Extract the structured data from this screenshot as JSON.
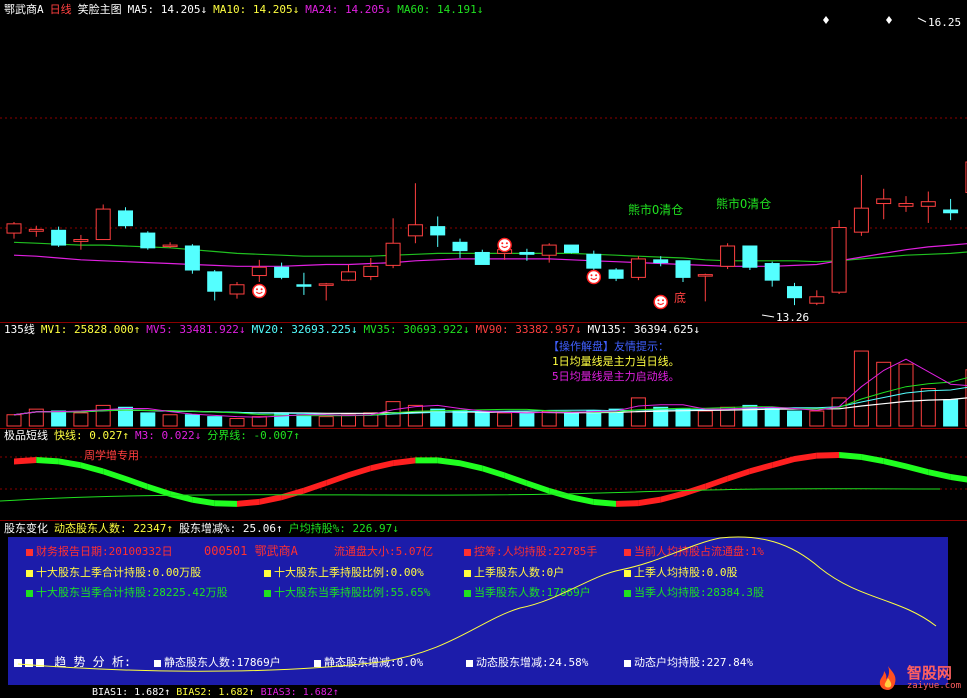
{
  "main": {
    "stock_name": "鄂武商A",
    "period": "日线",
    "indicator": "笑脸主图",
    "ma5": "MA5: 14.205↓",
    "ma10": "MA10: 14.205↓",
    "ma24": "MA24: 14.205↓",
    "ma60": "MA60: 14.191↓",
    "high_price": "16.25",
    "low_price": "13.26",
    "bear_label_1": "熊市O清仓",
    "bear_label_2": "熊市O清仓",
    "bottom_label": "底",
    "colors": {
      "up": "#ff4040",
      "down": "#54ffff",
      "ma_green": "#20c020",
      "ma_magenta": "#e020e0"
    },
    "candles": [
      {
        "o": 14.02,
        "c": 14.12,
        "h": 14.14,
        "l": 13.96
      },
      {
        "o": 14.04,
        "c": 14.06,
        "h": 14.1,
        "l": 13.98
      },
      {
        "o": 14.05,
        "c": 13.89,
        "h": 14.09,
        "l": 13.87
      },
      {
        "o": 13.93,
        "c": 13.95,
        "h": 14.0,
        "l": 13.84
      },
      {
        "o": 13.95,
        "c": 14.28,
        "h": 14.33,
        "l": 13.95
      },
      {
        "o": 14.26,
        "c": 14.1,
        "h": 14.3,
        "l": 14.07
      },
      {
        "o": 14.02,
        "c": 13.86,
        "h": 14.04,
        "l": 13.84
      },
      {
        "o": 13.88,
        "c": 13.89,
        "h": 13.92,
        "l": 13.86
      },
      {
        "o": 13.88,
        "c": 13.62,
        "h": 13.9,
        "l": 13.58
      },
      {
        "o": 13.6,
        "c": 13.39,
        "h": 13.62,
        "l": 13.29
      },
      {
        "o": 13.36,
        "c": 13.46,
        "h": 13.49,
        "l": 13.31
      },
      {
        "o": 13.56,
        "c": 13.65,
        "h": 13.73,
        "l": 13.49
      },
      {
        "o": 13.65,
        "c": 13.54,
        "h": 13.7,
        "l": 13.52
      },
      {
        "o": 13.46,
        "c": 13.45,
        "h": 13.59,
        "l": 13.35
      },
      {
        "o": 13.46,
        "c": 13.47,
        "h": 13.48,
        "l": 13.29
      },
      {
        "o": 13.51,
        "c": 13.6,
        "h": 13.68,
        "l": 13.5
      },
      {
        "o": 13.55,
        "c": 13.66,
        "h": 13.75,
        "l": 13.51
      },
      {
        "o": 13.67,
        "c": 13.91,
        "h": 14.18,
        "l": 13.64
      },
      {
        "o": 13.99,
        "c": 14.11,
        "h": 14.56,
        "l": 13.91
      },
      {
        "o": 14.09,
        "c": 14.0,
        "h": 14.2,
        "l": 13.87
      },
      {
        "o": 13.92,
        "c": 13.83,
        "h": 13.96,
        "l": 13.75
      },
      {
        "o": 13.81,
        "c": 13.68,
        "h": 13.84,
        "l": 13.68
      },
      {
        "o": 13.8,
        "c": 13.84,
        "h": 13.88,
        "l": 13.73
      },
      {
        "o": 13.81,
        "c": 13.79,
        "h": 13.85,
        "l": 13.72
      },
      {
        "o": 13.78,
        "c": 13.89,
        "h": 13.91,
        "l": 13.7
      },
      {
        "o": 13.89,
        "c": 13.81,
        "h": 13.89,
        "l": 13.8
      },
      {
        "o": 13.79,
        "c": 13.64,
        "h": 13.83,
        "l": 13.59
      },
      {
        "o": 13.62,
        "c": 13.53,
        "h": 13.64,
        "l": 13.5
      },
      {
        "o": 13.54,
        "c": 13.74,
        "h": 13.77,
        "l": 13.51
      },
      {
        "o": 13.73,
        "c": 13.7,
        "h": 13.77,
        "l": 13.66
      },
      {
        "o": 13.72,
        "c": 13.54,
        "h": 13.72,
        "l": 13.49
      },
      {
        "o": 13.57,
        "c": 13.57,
        "h": 13.58,
        "l": 13.28
      },
      {
        "o": 13.66,
        "c": 13.88,
        "h": 13.91,
        "l": 13.63
      },
      {
        "o": 13.88,
        "c": 13.65,
        "h": 13.88,
        "l": 13.62
      },
      {
        "o": 13.69,
        "c": 13.51,
        "h": 13.71,
        "l": 13.44
      },
      {
        "o": 13.44,
        "c": 13.32,
        "h": 13.48,
        "l": 13.24
      },
      {
        "o": 13.26,
        "c": 13.33,
        "h": 13.4,
        "l": 13.24
      },
      {
        "o": 13.38,
        "c": 14.08,
        "h": 14.16,
        "l": 13.36
      },
      {
        "o": 14.03,
        "c": 14.29,
        "h": 14.65,
        "l": 13.99
      },
      {
        "o": 14.34,
        "c": 14.39,
        "h": 14.5,
        "l": 14.17
      },
      {
        "o": 14.31,
        "c": 14.34,
        "h": 14.42,
        "l": 14.25
      },
      {
        "o": 14.31,
        "c": 14.36,
        "h": 14.47,
        "l": 14.13
      },
      {
        "o": 14.27,
        "c": 14.24,
        "h": 14.39,
        "l": 14.16
      },
      {
        "o": 14.46,
        "c": 14.79,
        "h": 14.87,
        "l": 14.43
      },
      {
        "o": 14.83,
        "c": 15.28,
        "h": 16.25,
        "l": 14.77
      }
    ],
    "ma_green": [
      13.92,
      13.91,
      13.9,
      13.89,
      13.89,
      13.88,
      13.87,
      13.86,
      13.84,
      13.82,
      13.8,
      13.79,
      13.78,
      13.77,
      13.77,
      13.77,
      13.77,
      13.78,
      13.79,
      13.8,
      13.8,
      13.8,
      13.8,
      13.8,
      13.8,
      13.8,
      13.79,
      13.78,
      13.77,
      13.76,
      13.75,
      13.73,
      13.72,
      13.72,
      13.72,
      13.72,
      13.71,
      13.72,
      13.74,
      13.76,
      13.78,
      13.79,
      13.8,
      13.82,
      13.83
    ],
    "ma_magenta": [
      13.78,
      13.77,
      13.75,
      13.73,
      13.72,
      13.71,
      13.7,
      13.69,
      13.68,
      13.67,
      13.66,
      13.66,
      13.66,
      13.67,
      13.68,
      13.68,
      13.69,
      13.7,
      13.72,
      13.73,
      13.74,
      13.74,
      13.74,
      13.74,
      13.74,
      13.73,
      13.72,
      13.71,
      13.7,
      13.69,
      13.68,
      13.67,
      13.66,
      13.66,
      13.66,
      13.67,
      13.68,
      13.72,
      13.76,
      13.8,
      13.84,
      13.87,
      13.89,
      13.91,
      13.93
    ]
  },
  "volume": {
    "title": "135线",
    "mv1": "MV1: 25828.000↑",
    "mv5": "MV5: 33481.922↓",
    "mv20": "MV20: 32693.225↓",
    "mv35": "MV35: 30693.922↓",
    "mv90": "MV90: 33382.957↓",
    "mv135": "MV135: 36394.625↓",
    "tip_title": "【操作解盘】友情提示：",
    "tip_line1": "1日均量线是主力当日线。",
    "tip_line2": "5日均量线是主力启动线。",
    "bars": [
      12,
      18,
      16,
      14,
      22,
      20,
      14,
      12,
      12,
      10,
      8,
      10,
      14,
      12,
      10,
      12,
      14,
      26,
      22,
      18,
      16,
      14,
      14,
      14,
      16,
      14,
      16,
      18,
      30,
      20,
      18,
      16,
      20,
      22,
      18,
      16,
      16,
      30,
      80,
      68,
      66,
      40,
      28,
      60,
      62
    ]
  },
  "short": {
    "title": "极品短线",
    "fast": "快线: 0.027↑",
    "m3": "M3: 0.022↓",
    "divide": "分界线: -0.007↑",
    "tag": "周学增专用"
  },
  "holder": {
    "title": "股东变化",
    "dyn_count": "动态股东人数: 22347↑",
    "change": "股东增减%: 25.06↑",
    "avg_hold": "户均持股%: 226.97↓",
    "rows": [
      [
        "财务报告日期:20100332日",
        "000501 鄂武商A",
        "流通盘大小:5.07亿",
        "控筹:人均持股:22785手",
        "当前人均持股占流通盘:1%"
      ],
      [
        "十大股东上季合计持股:0.00万股",
        "十大股东上季持股比例:0.00%",
        "上季股东人数:0户",
        "上季人均持股:0.0股"
      ],
      [
        "十大股东当季合计持股:28225.42万股",
        "十大股东当季持股比例:55.65%",
        "当季股东人数:17869户",
        "当季人均持股:28384.3股"
      ]
    ],
    "trend_label": "趋 势 分 析:",
    "static_count": "静态股东人数:17869户",
    "static_change": "静态股东增减:0.0%",
    "dyn_change": "动态股东增减:24.58%",
    "dyn_avg": "动态户均持股:227.84%"
  },
  "bias": {
    "bias1": "BIAS1: 1.682↑",
    "bias2": "BIAS2: 1.682↑",
    "bias3": "BIAS3: 1.682↑"
  },
  "watermark": {
    "cn": "智股网",
    "en": "zaiyue.com"
  }
}
